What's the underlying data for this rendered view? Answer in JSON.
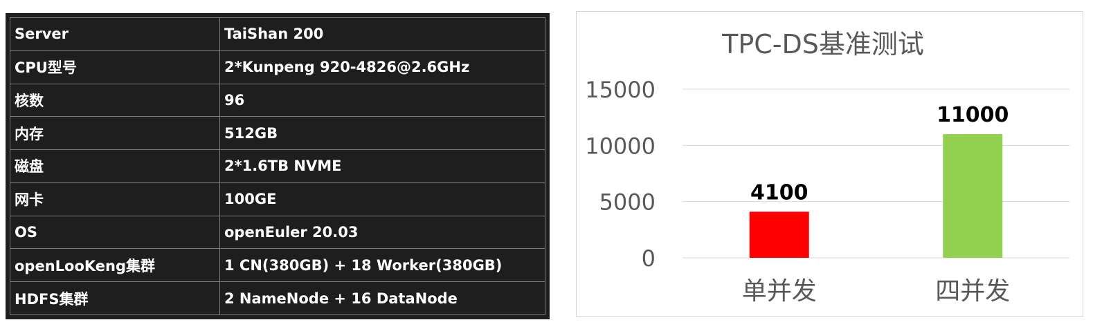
{
  "spec_table": {
    "rows": [
      {
        "key": "Server",
        "value": "TaiShan 200"
      },
      {
        "key": "CPU型号",
        "value": "2*Kunpeng 920-4826@2.6GHz"
      },
      {
        "key": "核数",
        "value": "96"
      },
      {
        "key": "内存",
        "value": "512GB"
      },
      {
        "key": "磁盘",
        "value": "2*1.6TB NVME"
      },
      {
        "key": "网卡",
        "value": "100GE"
      },
      {
        "key": "OS",
        "value": "openEuler 20.03"
      },
      {
        "key": "openLooKeng集群",
        "value": "1 CN(380GB) + 18 Worker(380GB)"
      },
      {
        "key": "HDFS集群",
        "value": "2 NameNode + 16 DataNode"
      }
    ]
  },
  "chart_data": {
    "type": "bar",
    "title": "TPC-DS基准测试",
    "categories": [
      "单并发",
      "四并发"
    ],
    "values": [
      4100,
      11000
    ],
    "data_labels": [
      "4100",
      "11000"
    ],
    "bar_colors": [
      "#ff0000",
      "#92d050"
    ],
    "y_ticks": [
      "0",
      "5000",
      "10000",
      "15000"
    ],
    "ylim": [
      0,
      15000
    ],
    "grid": true,
    "legend": "none"
  }
}
